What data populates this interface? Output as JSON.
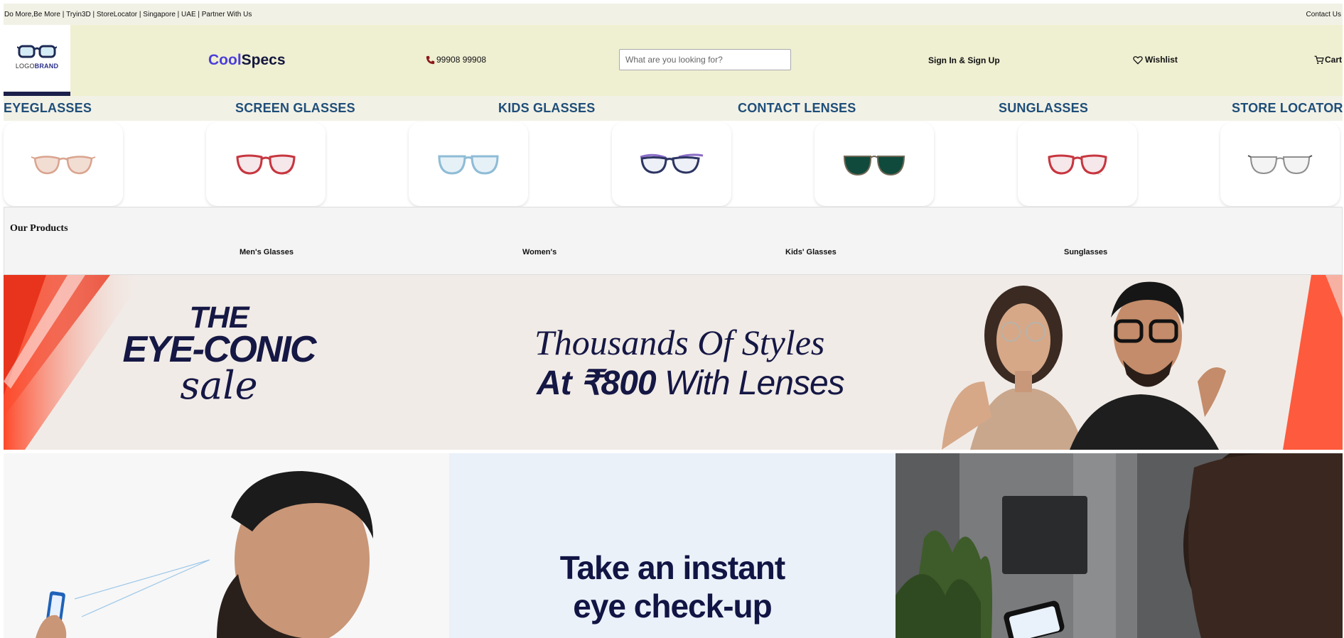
{
  "topbar": {
    "links": [
      "Do More,Be More",
      " | ",
      "Tryin3D",
      " | ",
      "StoreLocator",
      " | ",
      "Singapore",
      " | ",
      "UAE",
      " | ",
      "Partner With Us"
    ],
    "contact": "Contact Us"
  },
  "header": {
    "logo_text_a": "LOGO",
    "logo_text_b": "BRAND",
    "brand_a": "Cool",
    "brand_b": "Specs",
    "phone": "99908 99908",
    "search_placeholder": "What are you looking for?",
    "signin": "Sign In & Sign Up",
    "wishlist": "Wishlist",
    "cart": "Cart"
  },
  "nav": [
    "EYEGLASSES",
    "SCREEN GLASSES",
    "KIDS GLASSES",
    "CONTACT LENSES",
    "SUNGLASSES",
    "STORE LOCATOR"
  ],
  "frames": [
    {
      "name": "pink-frame",
      "color": "#d9a48f"
    },
    {
      "name": "red-frame",
      "color": "#c7363f"
    },
    {
      "name": "lightblue-frame",
      "color": "#8fbcd6"
    },
    {
      "name": "navy-purple-frame",
      "color": "#2c3562"
    },
    {
      "name": "green-sunglasses",
      "color": "#0f4a3c"
    },
    {
      "name": "red-frame",
      "color": "#c7363f"
    },
    {
      "name": "clear-frame",
      "color": "#8f8f8f"
    }
  ],
  "products": {
    "title": "Our Products",
    "items": [
      "Men's Glasses",
      "Women's",
      "Kids' Glasses",
      "Sunglasses"
    ]
  },
  "banner": {
    "sale_l1": "THE",
    "sale_l2": "EYE-CONIC",
    "sale_l3": "sale",
    "styles_line1": "Thousands Of Styles",
    "styles_line2_price": "At ₹800",
    "styles_line2_rest": " With Lenses"
  },
  "tiles": {
    "checkup_l1": "Take an instant",
    "checkup_l2": "eye check-up"
  },
  "colors": {
    "topbar_bg": "#f2f1e6",
    "header_bg": "#efefd2",
    "nav_text": "#1f4e79",
    "brand_cool": "#4b3fd9",
    "banner_navy": "#151744"
  }
}
